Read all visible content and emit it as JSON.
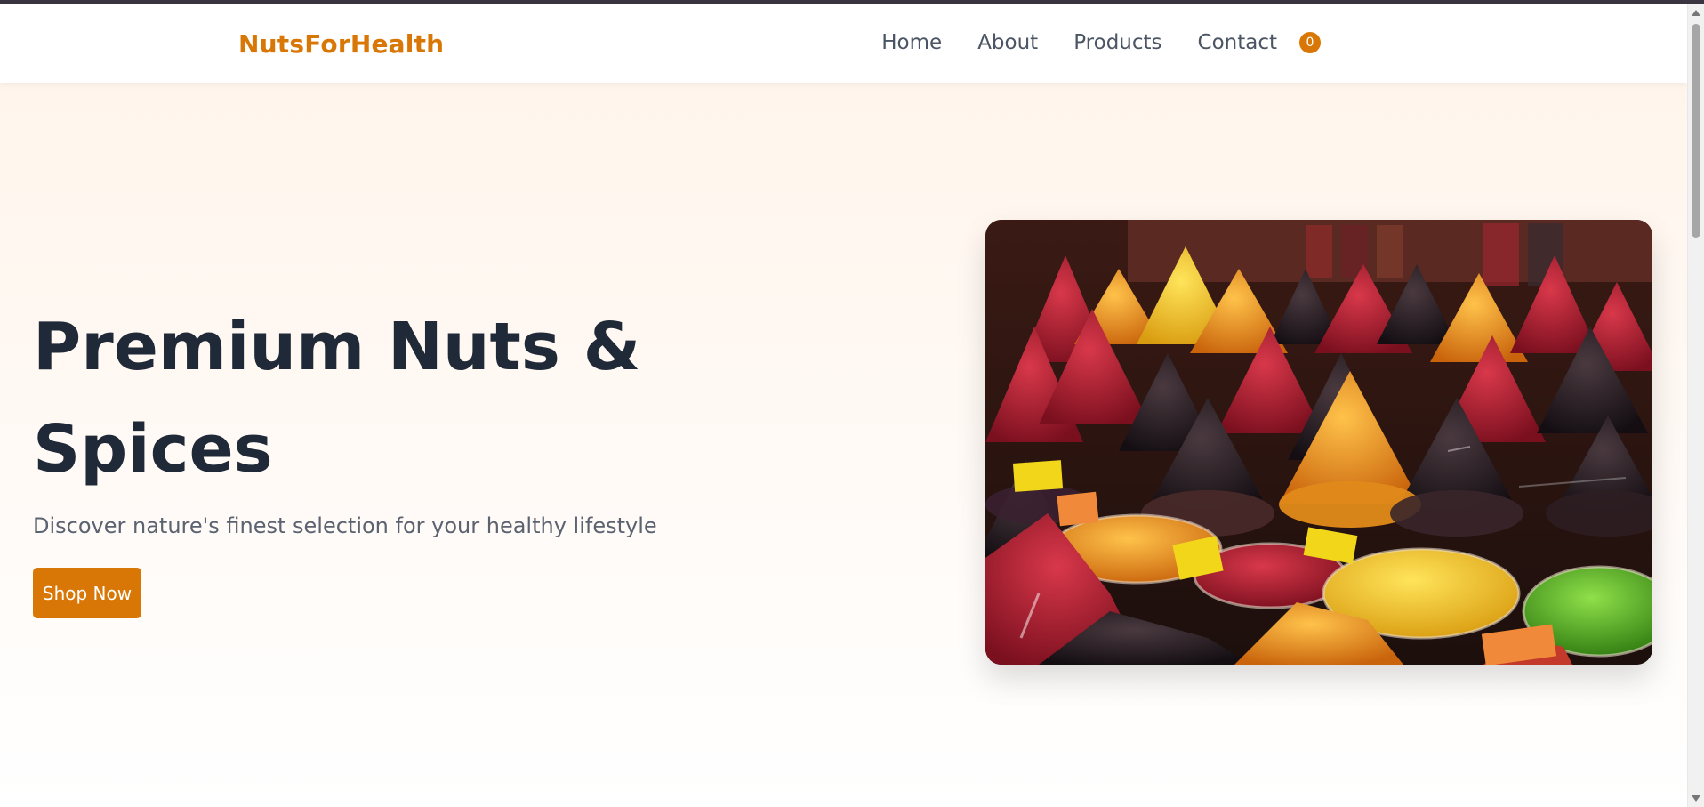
{
  "nav": {
    "brand": "NutsForHealth",
    "links": [
      "Home",
      "About",
      "Products",
      "Contact"
    ],
    "cart_count": "0"
  },
  "hero": {
    "title": "Premium Nuts & Spices",
    "subtitle": "Discover nature's finest selection for your healthy lifestyle",
    "cta_label": "Shop Now"
  },
  "colors": {
    "accent": "#d97706",
    "heading": "#1f2937",
    "text_muted": "#5b6270"
  },
  "icons": {
    "cart_badge": "cart-count-badge"
  }
}
